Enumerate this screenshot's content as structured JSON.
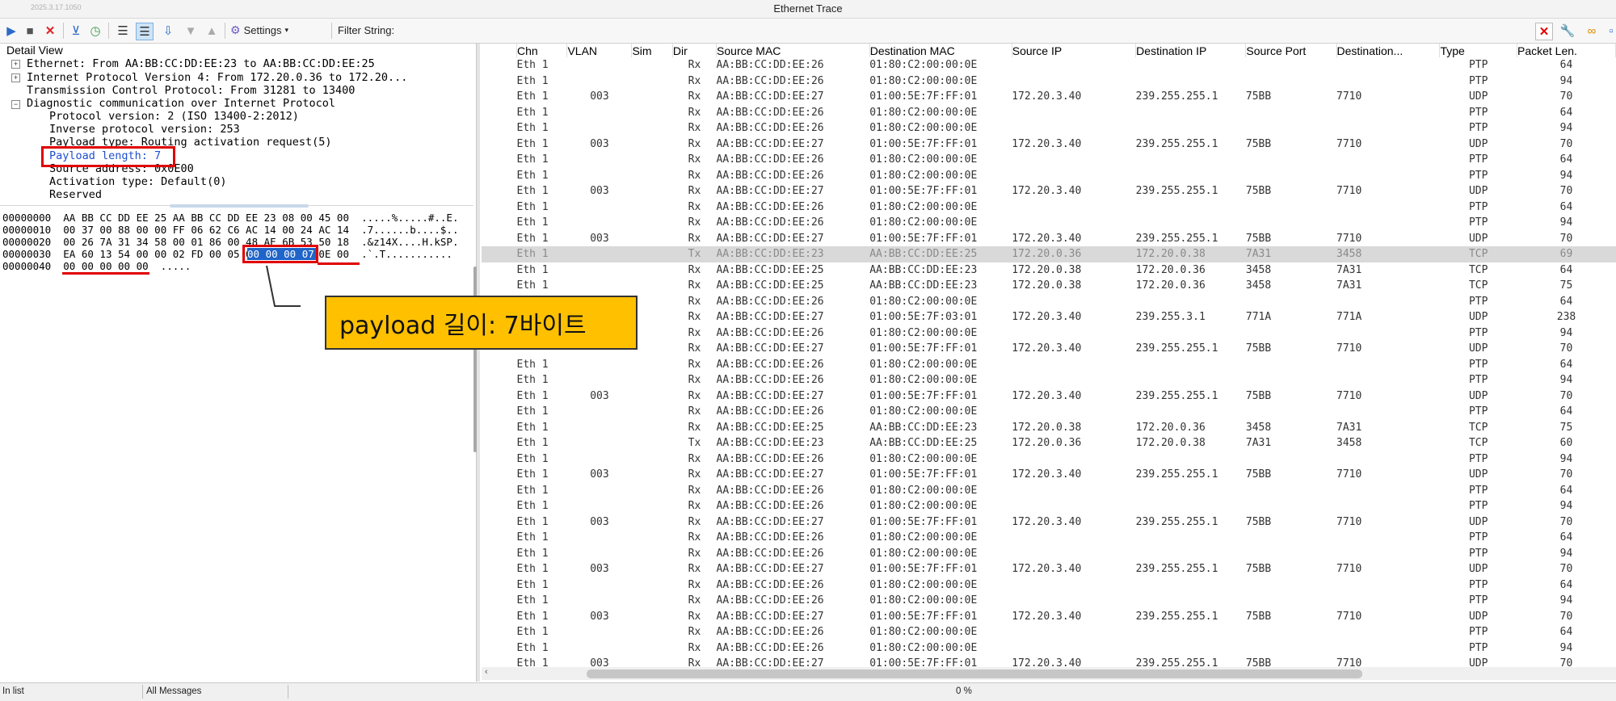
{
  "window": {
    "build": "2025.3.17.1050",
    "title": "Ethernet Trace"
  },
  "toolbar": {
    "settings_label": "Settings",
    "filter_label": "Filter String:",
    "icons": [
      "play-icon",
      "stop-icon",
      "close-icon",
      "filter-icon",
      "clock-icon",
      "list-icon",
      "list-active-icon",
      "sort-icon",
      "arrow-down-icon",
      "arrow-up-icon",
      "gear-icon",
      "close-red-icon",
      "wrench-icon",
      "link-icon"
    ]
  },
  "detail": {
    "header": "Detail View",
    "tree": [
      "Ethernet: From AA:BB:CC:DD:EE:23 to AA:BB:CC:DD:EE:25",
      "Internet Protocol Version 4: From 172.20.0.36 to 172.20...",
      "Transmission Control Protocol: From 31281 to 13400",
      "Diagnostic communication over Internet Protocol",
      "Protocol version: 2 (ISO 13400-2:2012)",
      "Inverse protocol version: 253",
      "Payload type: Routing activation request(5)",
      "Payload length: 7",
      "Source address: 0x0E00",
      "Activation type: Default(0)",
      "Reserved"
    ]
  },
  "hex": [
    {
      "offset": "00000000",
      "bytes": "AA BB CC DD EE 25 AA BB CC DD EE 23 08 00 45 00",
      "ascii": ".....%.....#..E."
    },
    {
      "offset": "00000010",
      "bytes": "00 37 00 88 00 00 FF 06 62 C6 AC 14 00 24 AC 14",
      "ascii": ".7......b....$.."
    },
    {
      "offset": "00000020",
      "bytes": "00 26 7A 31 34 58 00 01 86 00 48 AE 6B 53 50 18",
      "ascii": ".&z14X....H.kSP."
    },
    {
      "offset": "00000030",
      "bytes": "EA 60 13 54 00 00 02 FD 00 05 00 00 00 07 0E 00",
      "ascii": ".`.T..........."
    },
    {
      "offset": "00000040",
      "bytes": "00 00 00 00 00",
      "ascii": "....."
    }
  ],
  "hex_selected": "00 00 00 07",
  "annotation": {
    "text": "payload 길이: 7바이트"
  },
  "table": {
    "columns": [
      "Chn",
      "VLAN",
      "Sim",
      "Dir",
      "Source MAC",
      "Destination MAC",
      "Source IP",
      "Destination IP",
      "Source Port",
      "Destination...",
      "Type",
      "Packet Len."
    ],
    "rows": [
      [
        "Eth 1",
        "",
        "",
        "Rx",
        "AA:BB:CC:DD:EE:26",
        "01:80:C2:00:00:0E",
        "",
        "",
        "",
        "",
        "PTP",
        "64"
      ],
      [
        "Eth 1",
        "",
        "",
        "Rx",
        "AA:BB:CC:DD:EE:26",
        "01:80:C2:00:00:0E",
        "",
        "",
        "",
        "",
        "PTP",
        "94"
      ],
      [
        "Eth 1",
        "003",
        "",
        "Rx",
        "AA:BB:CC:DD:EE:27",
        "01:00:5E:7F:FF:01",
        "172.20.3.40",
        "239.255.255.1",
        "75BB",
        "7710",
        "UDP",
        "70"
      ],
      [
        "Eth 1",
        "",
        "",
        "Rx",
        "AA:BB:CC:DD:EE:26",
        "01:80:C2:00:00:0E",
        "",
        "",
        "",
        "",
        "PTP",
        "64"
      ],
      [
        "Eth 1",
        "",
        "",
        "Rx",
        "AA:BB:CC:DD:EE:26",
        "01:80:C2:00:00:0E",
        "",
        "",
        "",
        "",
        "PTP",
        "94"
      ],
      [
        "Eth 1",
        "003",
        "",
        "Rx",
        "AA:BB:CC:DD:EE:27",
        "01:00:5E:7F:FF:01",
        "172.20.3.40",
        "239.255.255.1",
        "75BB",
        "7710",
        "UDP",
        "70"
      ],
      [
        "Eth 1",
        "",
        "",
        "Rx",
        "AA:BB:CC:DD:EE:26",
        "01:80:C2:00:00:0E",
        "",
        "",
        "",
        "",
        "PTP",
        "64"
      ],
      [
        "Eth 1",
        "",
        "",
        "Rx",
        "AA:BB:CC:DD:EE:26",
        "01:80:C2:00:00:0E",
        "",
        "",
        "",
        "",
        "PTP",
        "94"
      ],
      [
        "Eth 1",
        "003",
        "",
        "Rx",
        "AA:BB:CC:DD:EE:27",
        "01:00:5E:7F:FF:01",
        "172.20.3.40",
        "239.255.255.1",
        "75BB",
        "7710",
        "UDP",
        "70"
      ],
      [
        "Eth 1",
        "",
        "",
        "Rx",
        "AA:BB:CC:DD:EE:26",
        "01:80:C2:00:00:0E",
        "",
        "",
        "",
        "",
        "PTP",
        "64"
      ],
      [
        "Eth 1",
        "",
        "",
        "Rx",
        "AA:BB:CC:DD:EE:26",
        "01:80:C2:00:00:0E",
        "",
        "",
        "",
        "",
        "PTP",
        "94"
      ],
      [
        "Eth 1",
        "003",
        "",
        "Rx",
        "AA:BB:CC:DD:EE:27",
        "01:00:5E:7F:FF:01",
        "172.20.3.40",
        "239.255.255.1",
        "75BB",
        "7710",
        "UDP",
        "70"
      ],
      [
        "Eth 1",
        "",
        "",
        "Tx",
        "AA:BB:CC:DD:EE:23",
        "AA:BB:CC:DD:EE:25",
        "172.20.0.36",
        "172.20.0.38",
        "7A31",
        "3458",
        "TCP",
        "69"
      ],
      [
        "Eth 1",
        "",
        "",
        "Rx",
        "AA:BB:CC:DD:EE:25",
        "AA:BB:CC:DD:EE:23",
        "172.20.0.38",
        "172.20.0.36",
        "3458",
        "7A31",
        "TCP",
        "64"
      ],
      [
        "Eth 1",
        "",
        "",
        "Rx",
        "AA:BB:CC:DD:EE:25",
        "AA:BB:CC:DD:EE:23",
        "172.20.0.38",
        "172.20.0.36",
        "3458",
        "7A31",
        "TCP",
        "75"
      ],
      [
        "",
        "",
        "",
        "Rx",
        "AA:BB:CC:DD:EE:26",
        "01:80:C2:00:00:0E",
        "",
        "",
        "",
        "",
        "PTP",
        "64"
      ],
      [
        "",
        "",
        "",
        "Rx",
        "AA:BB:CC:DD:EE:27",
        "01:00:5E:7F:03:01",
        "172.20.3.40",
        "239.255.3.1",
        "771A",
        "771A",
        "UDP",
        "238"
      ],
      [
        "",
        "",
        "",
        "Rx",
        "AA:BB:CC:DD:EE:26",
        "01:80:C2:00:00:0E",
        "",
        "",
        "",
        "",
        "PTP",
        "94"
      ],
      [
        "",
        "",
        "",
        "Rx",
        "AA:BB:CC:DD:EE:27",
        "01:00:5E:7F:FF:01",
        "172.20.3.40",
        "239.255.255.1",
        "75BB",
        "7710",
        "UDP",
        "70"
      ],
      [
        "Eth 1",
        "",
        "",
        "Rx",
        "AA:BB:CC:DD:EE:26",
        "01:80:C2:00:00:0E",
        "",
        "",
        "",
        "",
        "PTP",
        "64"
      ],
      [
        "Eth 1",
        "",
        "",
        "Rx",
        "AA:BB:CC:DD:EE:26",
        "01:80:C2:00:00:0E",
        "",
        "",
        "",
        "",
        "PTP",
        "94"
      ],
      [
        "Eth 1",
        "003",
        "",
        "Rx",
        "AA:BB:CC:DD:EE:27",
        "01:00:5E:7F:FF:01",
        "172.20.3.40",
        "239.255.255.1",
        "75BB",
        "7710",
        "UDP",
        "70"
      ],
      [
        "Eth 1",
        "",
        "",
        "Rx",
        "AA:BB:CC:DD:EE:26",
        "01:80:C2:00:00:0E",
        "",
        "",
        "",
        "",
        "PTP",
        "64"
      ],
      [
        "Eth 1",
        "",
        "",
        "Rx",
        "AA:BB:CC:DD:EE:25",
        "AA:BB:CC:DD:EE:23",
        "172.20.0.38",
        "172.20.0.36",
        "3458",
        "7A31",
        "TCP",
        "75"
      ],
      [
        "Eth 1",
        "",
        "",
        "Tx",
        "AA:BB:CC:DD:EE:23",
        "AA:BB:CC:DD:EE:25",
        "172.20.0.36",
        "172.20.0.38",
        "7A31",
        "3458",
        "TCP",
        "60"
      ],
      [
        "Eth 1",
        "",
        "",
        "Rx",
        "AA:BB:CC:DD:EE:26",
        "01:80:C2:00:00:0E",
        "",
        "",
        "",
        "",
        "PTP",
        "94"
      ],
      [
        "Eth 1",
        "003",
        "",
        "Rx",
        "AA:BB:CC:DD:EE:27",
        "01:00:5E:7F:FF:01",
        "172.20.3.40",
        "239.255.255.1",
        "75BB",
        "7710",
        "UDP",
        "70"
      ],
      [
        "Eth 1",
        "",
        "",
        "Rx",
        "AA:BB:CC:DD:EE:26",
        "01:80:C2:00:00:0E",
        "",
        "",
        "",
        "",
        "PTP",
        "64"
      ],
      [
        "Eth 1",
        "",
        "",
        "Rx",
        "AA:BB:CC:DD:EE:26",
        "01:80:C2:00:00:0E",
        "",
        "",
        "",
        "",
        "PTP",
        "94"
      ],
      [
        "Eth 1",
        "003",
        "",
        "Rx",
        "AA:BB:CC:DD:EE:27",
        "01:00:5E:7F:FF:01",
        "172.20.3.40",
        "239.255.255.1",
        "75BB",
        "7710",
        "UDP",
        "70"
      ],
      [
        "Eth 1",
        "",
        "",
        "Rx",
        "AA:BB:CC:DD:EE:26",
        "01:80:C2:00:00:0E",
        "",
        "",
        "",
        "",
        "PTP",
        "64"
      ],
      [
        "Eth 1",
        "",
        "",
        "Rx",
        "AA:BB:CC:DD:EE:26",
        "01:80:C2:00:00:0E",
        "",
        "",
        "",
        "",
        "PTP",
        "94"
      ],
      [
        "Eth 1",
        "003",
        "",
        "Rx",
        "AA:BB:CC:DD:EE:27",
        "01:00:5E:7F:FF:01",
        "172.20.3.40",
        "239.255.255.1",
        "75BB",
        "7710",
        "UDP",
        "70"
      ],
      [
        "Eth 1",
        "",
        "",
        "Rx",
        "AA:BB:CC:DD:EE:26",
        "01:80:C2:00:00:0E",
        "",
        "",
        "",
        "",
        "PTP",
        "64"
      ],
      [
        "Eth 1",
        "",
        "",
        "Rx",
        "AA:BB:CC:DD:EE:26",
        "01:80:C2:00:00:0E",
        "",
        "",
        "",
        "",
        "PTP",
        "94"
      ],
      [
        "Eth 1",
        "003",
        "",
        "Rx",
        "AA:BB:CC:DD:EE:27",
        "01:00:5E:7F:FF:01",
        "172.20.3.40",
        "239.255.255.1",
        "75BB",
        "7710",
        "UDP",
        "70"
      ],
      [
        "Eth 1",
        "",
        "",
        "Rx",
        "AA:BB:CC:DD:EE:26",
        "01:80:C2:00:00:0E",
        "",
        "",
        "",
        "",
        "PTP",
        "64"
      ],
      [
        "Eth 1",
        "",
        "",
        "Rx",
        "AA:BB:CC:DD:EE:26",
        "01:80:C2:00:00:0E",
        "",
        "",
        "",
        "",
        "PTP",
        "94"
      ],
      [
        "Eth 1",
        "003",
        "",
        "Rx",
        "AA:BB:CC:DD:EE:27",
        "01:00:5E:7F:FF:01",
        "172.20.3.40",
        "239.255.255.1",
        "75BB",
        "7710",
        "UDP",
        "70"
      ]
    ],
    "selected_index": 12
  },
  "status": {
    "left": "In list",
    "mid": "All Messages",
    "progress": "0 %"
  }
}
